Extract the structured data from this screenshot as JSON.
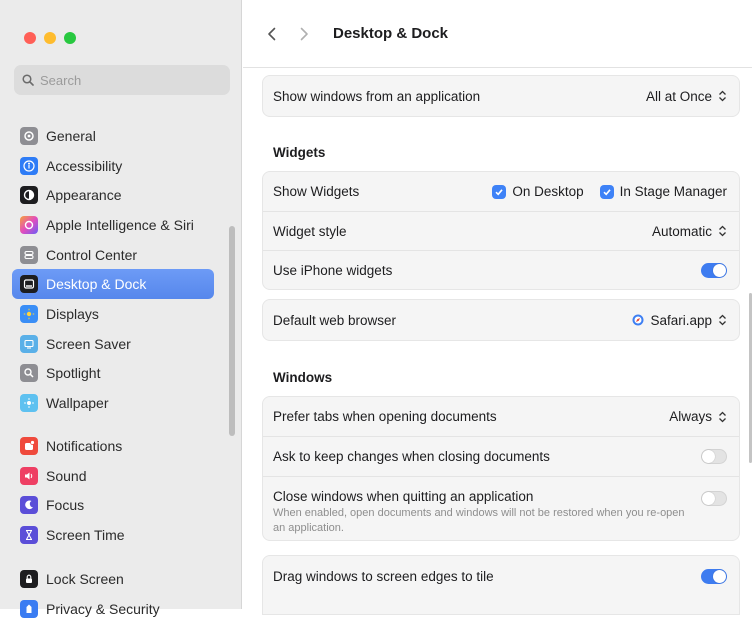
{
  "window": {
    "title": "Desktop & Dock",
    "traffic_colors": [
      "#ff5f57",
      "#febc2e",
      "#28c840"
    ]
  },
  "search": {
    "placeholder": "Search"
  },
  "sidebar": {
    "group1": [
      {
        "label": "General",
        "icon": "gear-icon",
        "color": "#8e8e93"
      },
      {
        "label": "Accessibility",
        "icon": "accessibility-icon",
        "color": "#2e7cf6"
      },
      {
        "label": "Appearance",
        "icon": "appearance-icon",
        "color": "#1d1d1f"
      },
      {
        "label": "Apple Intelligence & Siri",
        "icon": "siri-icon",
        "color": "#e24dbd"
      },
      {
        "label": "Control Center",
        "icon": "control-center-icon",
        "color": "#8e8e93"
      },
      {
        "label": "Desktop & Dock",
        "icon": "dock-icon",
        "color": "#1d1d1f",
        "active": true
      },
      {
        "label": "Displays",
        "icon": "displays-icon",
        "color": "#3a8ef6"
      },
      {
        "label": "Screen Saver",
        "icon": "screen-saver-icon",
        "color": "#5ab0e8"
      },
      {
        "label": "Spotlight",
        "icon": "spotlight-icon",
        "color": "#8e8e93"
      },
      {
        "label": "Wallpaper",
        "icon": "wallpaper-icon",
        "color": "#5ec1f0"
      }
    ],
    "group2": [
      {
        "label": "Notifications",
        "icon": "notifications-icon",
        "color": "#ef4a3c"
      },
      {
        "label": "Sound",
        "icon": "sound-icon",
        "color": "#ee3f63"
      },
      {
        "label": "Focus",
        "icon": "focus-icon",
        "color": "#5b4ed8"
      },
      {
        "label": "Screen Time",
        "icon": "screen-time-icon",
        "color": "#5b4ed8"
      }
    ],
    "group3": [
      {
        "label": "Lock Screen",
        "icon": "lock-icon",
        "color": "#1d1d1f"
      },
      {
        "label": "Privacy & Security",
        "icon": "privacy-icon",
        "color": "#3a7cf2"
      }
    ]
  },
  "main": {
    "top_row": {
      "label": "Show windows from an application",
      "value": "All at Once"
    },
    "widgets": {
      "heading": "Widgets",
      "show_widgets": {
        "label": "Show Widgets",
        "options": [
          {
            "label": "On Desktop",
            "checked": true
          },
          {
            "label": "In Stage Manager",
            "checked": true
          }
        ]
      },
      "widget_style": {
        "label": "Widget style",
        "value": "Automatic"
      },
      "iphone_widgets": {
        "label": "Use iPhone widgets",
        "on": true
      }
    },
    "browser": {
      "label": "Default web browser",
      "value": "Safari.app"
    },
    "windows": {
      "heading": "Windows",
      "prefer_tabs": {
        "label": "Prefer tabs when opening documents",
        "value": "Always"
      },
      "ask_keep": {
        "label": "Ask to keep changes when closing documents",
        "on": false
      },
      "close_windows": {
        "label": "Close windows when quitting an application",
        "description": "When enabled, open documents and windows will not be restored when you re-open an application.",
        "on": false
      }
    },
    "tiling": {
      "label": "Drag windows to screen edges to tile",
      "on": true
    }
  }
}
